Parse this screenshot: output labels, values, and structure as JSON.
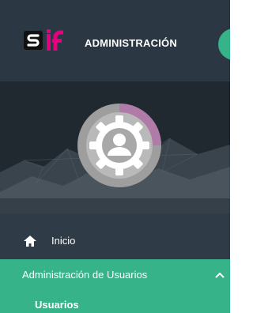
{
  "header": {
    "admin_title": "ADMINISTRACIÓN",
    "logo_name": "sif-logo",
    "accent_color": "#36b389"
  },
  "banner": {
    "avatar_name": "user-profile-avatar"
  },
  "nav": {
    "inicio": "Inicio",
    "admin_usuarios": "Administración de Usuarios",
    "usuarios": "Usuarios"
  }
}
